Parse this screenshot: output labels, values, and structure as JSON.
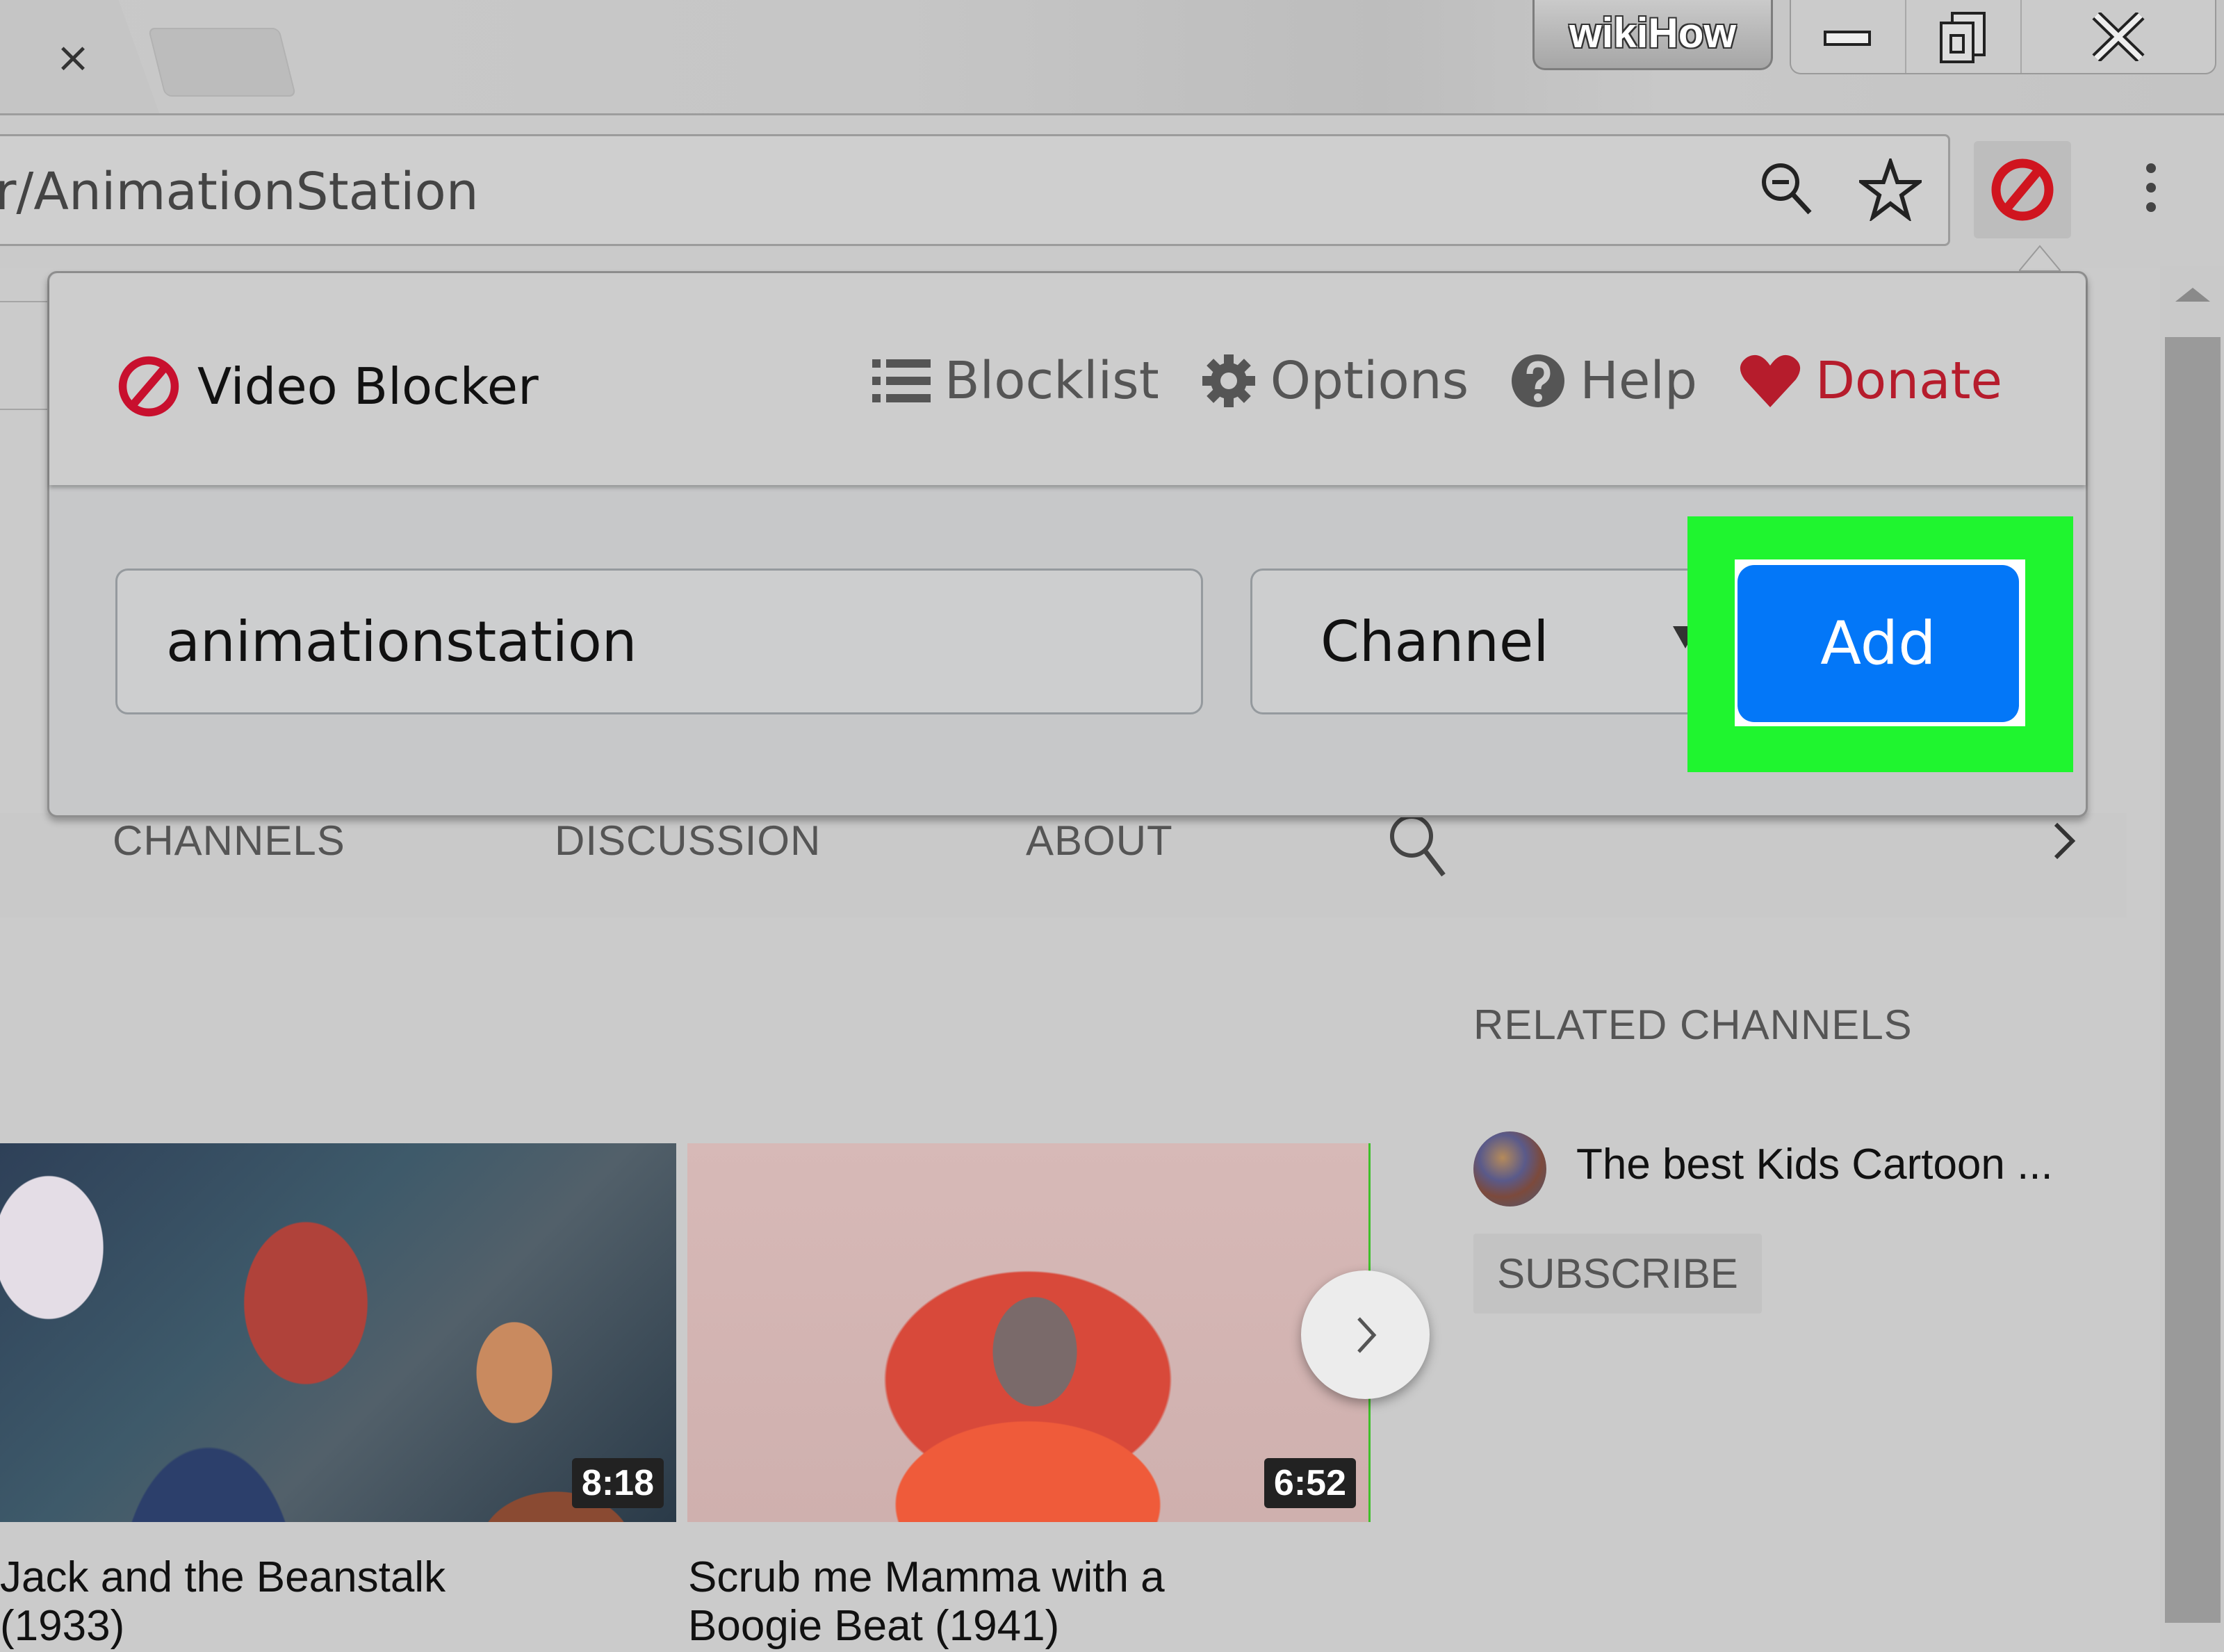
{
  "browser": {
    "active_tab_close": "×",
    "watermark": "wikiHow",
    "url": "r/AnimationStation",
    "window_controls": [
      "minimize",
      "restore",
      "close"
    ]
  },
  "page": {
    "tabs": [
      "CHANNELS",
      "DISCUSSION",
      "ABOUT"
    ],
    "related": {
      "title": "RELATED CHANNELS",
      "channel_name": "The best Kids Cartoon ...",
      "subscribe_label": "SUBSCRIBE"
    },
    "videos": [
      {
        "title_line1": "Jack and the Beanstalk",
        "title_line2": "(1933)",
        "duration": "8:18"
      },
      {
        "title_line1": "Scrub me Mamma with a",
        "title_line2": "Boogie Beat (1941)",
        "duration": "6:52"
      }
    ]
  },
  "popup": {
    "brand": "Video Blocker",
    "nav": {
      "blocklist": "Blocklist",
      "options": "Options",
      "help": "Help",
      "donate": "Donate"
    },
    "input_value": "animationstation",
    "select_value": "Channel",
    "add_label": "Add"
  },
  "colors": {
    "brand_red": "#c8102e",
    "donate_red": "#b61c2c",
    "add_blue": "#0377f8",
    "highlight_green": "#1ff52f"
  }
}
